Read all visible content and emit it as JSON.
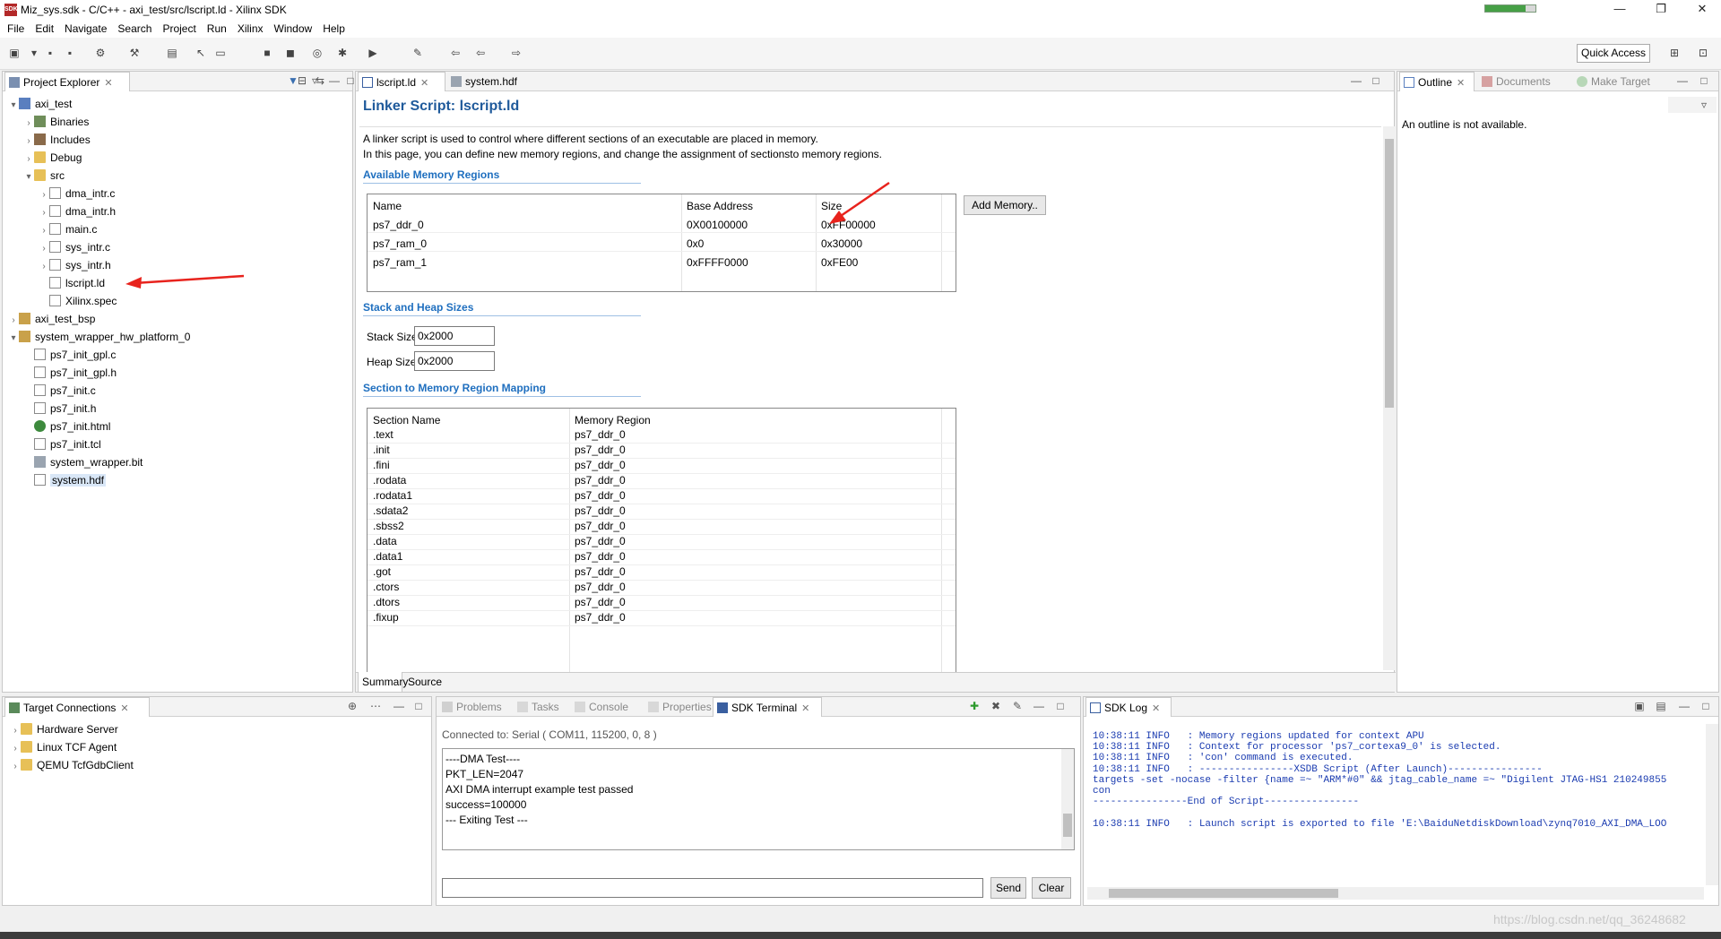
{
  "window": {
    "title": "Miz_sys.sdk - C/C++ - axi_test/src/lscript.ld - Xilinx SDK",
    "app_icon": "SDK",
    "progress": 0.8
  },
  "menu": [
    "File",
    "Edit",
    "Navigate",
    "Search",
    "Project",
    "Run",
    "Xilinx",
    "Window",
    "Help"
  ],
  "toolbar": {
    "quick_access": "Quick Access"
  },
  "project_explorer": {
    "tab": "Project Explorer",
    "items": [
      {
        "label": "axi_test",
        "depth": 0,
        "arrow": "▾",
        "icon": "proj"
      },
      {
        "label": "Binaries",
        "depth": 1,
        "arrow": "›",
        "icon": "bin"
      },
      {
        "label": "Includes",
        "depth": 1,
        "arrow": "›",
        "icon": "inc"
      },
      {
        "label": "Debug",
        "depth": 1,
        "arrow": "›",
        "icon": "folder"
      },
      {
        "label": "src",
        "depth": 1,
        "arrow": "▾",
        "icon": "folder"
      },
      {
        "label": "dma_intr.c",
        "depth": 2,
        "arrow": "›",
        "icon": "c"
      },
      {
        "label": "dma_intr.h",
        "depth": 2,
        "arrow": "›",
        "icon": "h"
      },
      {
        "label": "main.c",
        "depth": 2,
        "arrow": "›",
        "icon": "c"
      },
      {
        "label": "sys_intr.c",
        "depth": 2,
        "arrow": "›",
        "icon": "c"
      },
      {
        "label": "sys_intr.h",
        "depth": 2,
        "arrow": "›",
        "icon": "h"
      },
      {
        "label": "lscript.ld",
        "depth": 2,
        "arrow": "",
        "icon": "ld"
      },
      {
        "label": "Xilinx.spec",
        "depth": 2,
        "arrow": "",
        "icon": "file"
      },
      {
        "label": "axi_test_bsp",
        "depth": 0,
        "arrow": "›",
        "icon": "bsp"
      },
      {
        "label": "system_wrapper_hw_platform_0",
        "depth": 0,
        "arrow": "▾",
        "icon": "bsp"
      },
      {
        "label": "ps7_init_gpl.c",
        "depth": 1,
        "arrow": "",
        "icon": "c"
      },
      {
        "label": "ps7_init_gpl.h",
        "depth": 1,
        "arrow": "",
        "icon": "h"
      },
      {
        "label": "ps7_init.c",
        "depth": 1,
        "arrow": "",
        "icon": "c"
      },
      {
        "label": "ps7_init.h",
        "depth": 1,
        "arrow": "",
        "icon": "h"
      },
      {
        "label": "ps7_init.html",
        "depth": 1,
        "arrow": "",
        "icon": "web"
      },
      {
        "label": "ps7_init.tcl",
        "depth": 1,
        "arrow": "",
        "icon": "file"
      },
      {
        "label": "system_wrapper.bit",
        "depth": 1,
        "arrow": "",
        "icon": "bit"
      },
      {
        "label": "system.hdf",
        "depth": 1,
        "arrow": "",
        "icon": "hdf",
        "selected": true
      }
    ]
  },
  "editor": {
    "tabs": [
      "lscript.ld",
      "system.hdf"
    ],
    "title": "Linker Script: lscript.ld",
    "desc_line1": "A linker script is used to control where different sections of an executable are placed in memory.",
    "desc_line2": "In this page, you can define new memory regions, and change the assignment of sectionsto memory regions.",
    "memory_section": "Available Memory Regions",
    "memory_headers": [
      "Name",
      "Base Address",
      "Size"
    ],
    "memory_rows": [
      [
        "ps7_ddr_0",
        "0X00100000",
        "0xFF00000"
      ],
      [
        "ps7_ram_0",
        "0x0",
        "0x30000"
      ],
      [
        "ps7_ram_1",
        "0xFFFF0000",
        "0xFE00"
      ]
    ],
    "add_memory": "Add Memory..",
    "stack_section": "Stack and Heap Sizes",
    "stack_label": "Stack Size",
    "stack_value": "0x2000",
    "heap_label": "Heap Size",
    "heap_value": "0x2000",
    "mapping_section": "Section to Memory Region Mapping",
    "mapping_headers": [
      "Section Name",
      "Memory Region"
    ],
    "mapping_rows": [
      [
        ".text",
        "ps7_ddr_0"
      ],
      [
        ".init",
        "ps7_ddr_0"
      ],
      [
        ".fini",
        "ps7_ddr_0"
      ],
      [
        ".rodata",
        "ps7_ddr_0"
      ],
      [
        ".rodata1",
        "ps7_ddr_0"
      ],
      [
        ".sdata2",
        "ps7_ddr_0"
      ],
      [
        ".sbss2",
        "ps7_ddr_0"
      ],
      [
        ".data",
        "ps7_ddr_0"
      ],
      [
        ".data1",
        "ps7_ddr_0"
      ],
      [
        ".got",
        "ps7_ddr_0"
      ],
      [
        ".ctors",
        "ps7_ddr_0"
      ],
      [
        ".dtors",
        "ps7_ddr_0"
      ],
      [
        ".fixup",
        "ps7_ddr_0"
      ]
    ],
    "bottom_tabs": [
      "Summary",
      "Source"
    ]
  },
  "outline": {
    "tabs": [
      "Outline",
      "Documents",
      "Make Target"
    ],
    "message": "An outline is not available."
  },
  "target_connections": {
    "tab": "Target Connections",
    "items": [
      "Hardware Server",
      "Linux TCF Agent",
      "QEMU TcfGdbClient"
    ]
  },
  "terminal": {
    "tabs": [
      "Problems",
      "Tasks",
      "Console",
      "Properties",
      "SDK Terminal"
    ],
    "status": "Connected to: Serial ( COM11, 115200, 0, 8 )",
    "lines": [
      "----DMA Test----",
      "PKT_LEN=2047",
      "AXI DMA interrupt example test passed",
      "success=100000",
      "--- Exiting Test ---"
    ],
    "send": "Send",
    "clear": "Clear"
  },
  "sdk_log": {
    "tab": "SDK Log",
    "lines": [
      "10:38:11 INFO   : Memory regions updated for context APU",
      "10:38:11 INFO   : Context for processor 'ps7_cortexa9_0' is selected.",
      "10:38:11 INFO   : 'con' command is executed.",
      "10:38:11 INFO   : ----------------XSDB Script (After Launch)----------------",
      "targets -set -nocase -filter {name =~ \"ARM*#0\" && jtag_cable_name =~ \"Digilent JTAG-HS1 210249855",
      "con",
      "----------------End of Script----------------",
      "",
      "10:38:11 INFO   : Launch script is exported to file 'E:\\BaiduNetdiskDownload\\zynq7010_AXI_DMA_LOO"
    ]
  },
  "watermark": "https://blog.csdn.net/qq_36248682",
  "colors": {
    "accent": "#1f5a9b",
    "section": "#1f6fbf",
    "log_text": "#1a3bb0",
    "arrow": "#e8231d"
  }
}
